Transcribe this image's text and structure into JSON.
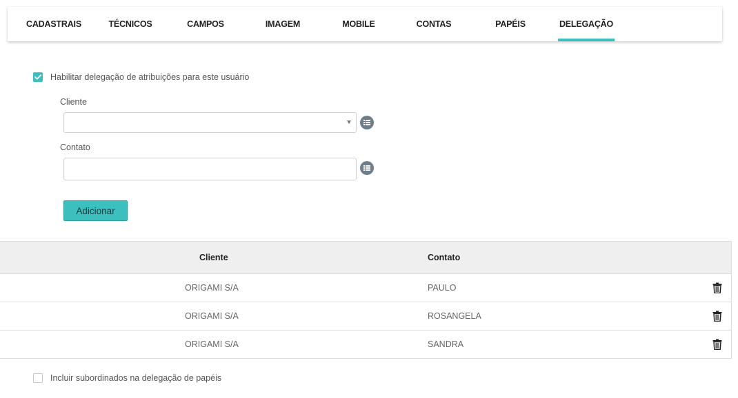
{
  "tabs": [
    {
      "label": "CADASTRAIS",
      "active": false
    },
    {
      "label": "TÉCNICOS",
      "active": false
    },
    {
      "label": "CAMPOS",
      "active": false
    },
    {
      "label": "IMAGEM",
      "active": false
    },
    {
      "label": "MOBILE",
      "active": false
    },
    {
      "label": "CONTAS",
      "active": false
    },
    {
      "label": "PAPÉIS",
      "active": false
    },
    {
      "label": "DELEGAÇÃO",
      "active": true
    }
  ],
  "enable_delegation": {
    "label": "Habilitar delegação de atribuições para este usuário",
    "checked": true
  },
  "form": {
    "cliente_label": "Cliente",
    "cliente_value": "",
    "contato_label": "Contato",
    "contato_value": "",
    "add_label": "Adicionar"
  },
  "table": {
    "headers": {
      "cliente": "Cliente",
      "contato": "Contato"
    },
    "rows": [
      {
        "cliente": "ORIGAMI S/A",
        "contato": "PAULO"
      },
      {
        "cliente": "ORIGAMI S/A",
        "contato": "ROSANGELA"
      },
      {
        "cliente": "ORIGAMI S/A",
        "contato": "SANDRA"
      }
    ]
  },
  "include_subordinates": {
    "label": "Incluir subordinados na delegação de papéis",
    "checked": false
  },
  "colors": {
    "accent": "#3bbfbf",
    "icon_grey": "#6d7f8a"
  },
  "icons": {
    "list": "list-icon",
    "trash": "trash-icon",
    "check": "check-icon",
    "caret": "chevron-down-icon"
  }
}
